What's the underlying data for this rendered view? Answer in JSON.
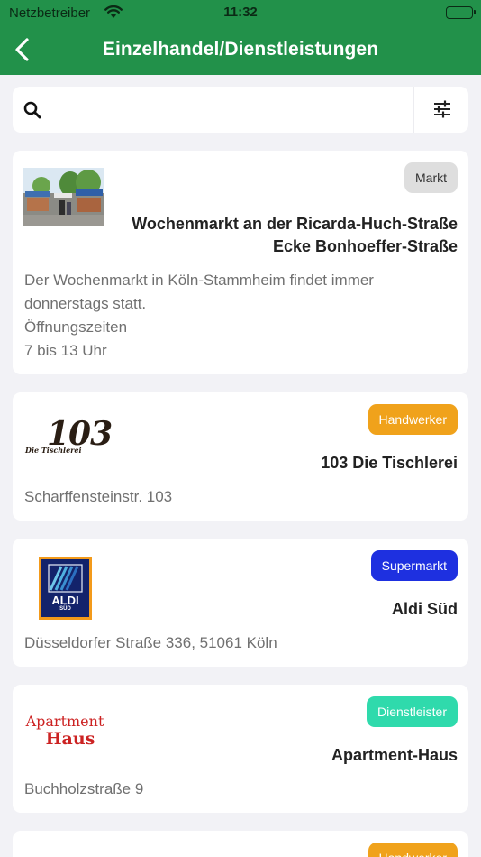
{
  "status_bar": {
    "carrier": "Netzbetreiber",
    "time": "11:32"
  },
  "nav": {
    "title": "Einzelhandel/Dienstleistungen"
  },
  "search": {
    "placeholder": ""
  },
  "listings": [
    {
      "category": "Markt",
      "name_line1": "Wochenmarkt an der Ricarda-Huch-Straße",
      "name_line2": "Ecke Bonhoeffer-Straße",
      "description": "Der Wochenmarkt  in Köln-Stammheim findet immer donnerstags statt.\nÖffnungszeiten\n7 bis 13 Uhr"
    },
    {
      "category": "Handwerker",
      "name": "103 Die Tischlerei",
      "address": "Scharffensteinstr. 103",
      "logo_text": "103",
      "logo_subtext": "Die Tischlerei"
    },
    {
      "category": "Supermarkt",
      "name": "Aldi Süd",
      "address": "Düsseldorfer Straße 336, 51061 Köln",
      "logo_text": "ALDI",
      "logo_subtext": "SÜD"
    },
    {
      "category": "Dienstleister",
      "name": "Apartment-Haus",
      "address": "Buchholzstraße 9",
      "logo_text": "Apartment",
      "logo_subtext": "Haus"
    },
    {
      "category": "Handwerker"
    }
  ],
  "colors": {
    "brand_green": "#22914a",
    "badge_markt": "#dedede",
    "badge_handwerker": "#f0a21b",
    "badge_supermarkt": "#1e30e0",
    "badge_dienstleister": "#2fdaac"
  }
}
